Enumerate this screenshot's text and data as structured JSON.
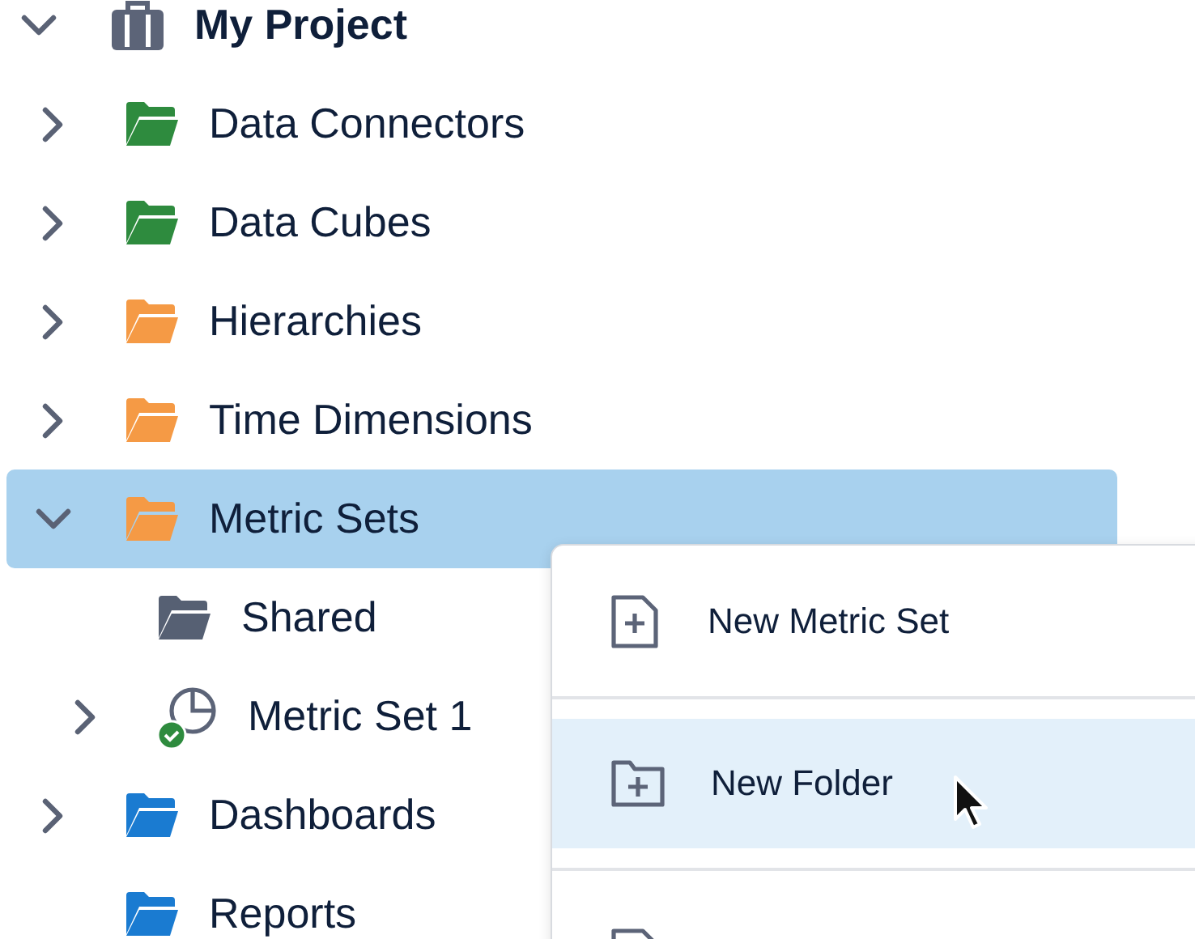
{
  "tree": {
    "label": "My Project",
    "kind": "project",
    "expanded": true,
    "selected": false,
    "children": [
      {
        "label": "Data Connectors",
        "kind": "folder",
        "color": "#2e8b3e",
        "expanded": false,
        "selected": false
      },
      {
        "label": "Data Cubes",
        "kind": "folder",
        "color": "#2e8b3e",
        "expanded": false,
        "selected": false
      },
      {
        "label": "Hierarchies",
        "kind": "folder",
        "color": "#f59a45",
        "expanded": false,
        "selected": false
      },
      {
        "label": "Time Dimensions",
        "kind": "folder",
        "color": "#f59a45",
        "expanded": false,
        "selected": false
      },
      {
        "label": "Metric Sets",
        "kind": "folder",
        "color": "#f59a45",
        "expanded": true,
        "selected": true,
        "children": [
          {
            "label": "Shared",
            "kind": "folder",
            "color": "#566073",
            "selected": false
          },
          {
            "label": "Metric Set 1",
            "kind": "metric-set",
            "verified": true,
            "expanded": false,
            "selected": false
          }
        ]
      },
      {
        "label": "Dashboards",
        "kind": "folder",
        "color": "#1a7bd1",
        "expanded": false,
        "selected": false
      },
      {
        "label": "Reports",
        "kind": "folder",
        "color": "#1a7bd1",
        "selected": false
      }
    ]
  },
  "context_menu": {
    "items": [
      {
        "label": "New Metric Set",
        "kind": "file-plus",
        "selected": false
      },
      {
        "label": "New Folder",
        "kind": "folder-plus",
        "selected": true
      },
      {
        "kind": "file",
        "selected": false
      }
    ]
  }
}
